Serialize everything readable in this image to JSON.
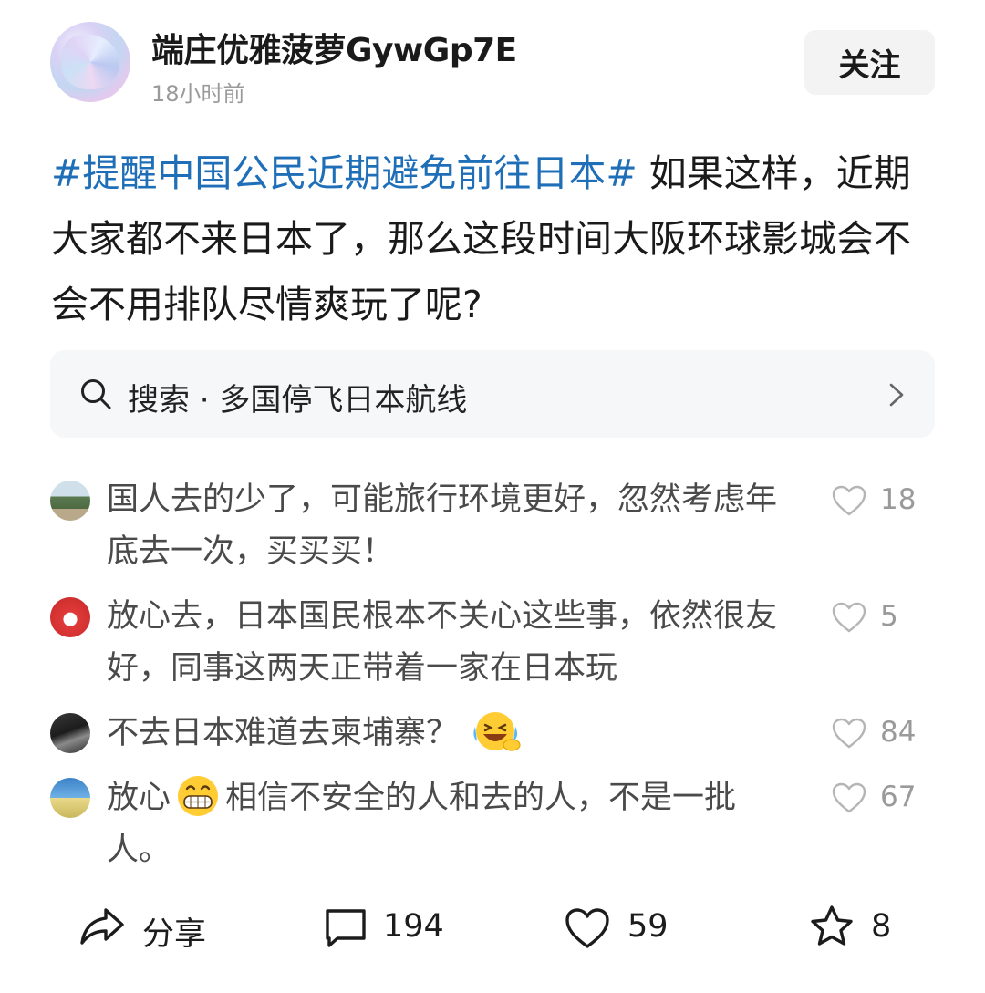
{
  "header": {
    "username": "端庄优雅菠萝GywGp7E",
    "time": "18小时前",
    "follow_label": "关注"
  },
  "post": {
    "hashtag": "#提醒中国公民近期避免前往日本#",
    "body": " 如果这样，近期大家都不来日本了，那么这段时间大阪环球影城会不会不用排队尽情爽玩了呢?"
  },
  "search": {
    "label": "搜索 · 多国停飞日本航线"
  },
  "comments": [
    {
      "text": "国人去的少了，可能旅行环境更好，忽然考虑年底去一次，买买买！",
      "likes": "18"
    },
    {
      "text": "放心去，日本国民根本不关心这些事，依然很友好，同事这两天正带着一家在日本玩",
      "likes": "5"
    },
    {
      "text": "不去日本难道去柬埔寨？",
      "likes": "84"
    },
    {
      "text_before": "放心",
      "text_after": "相信不安全的人和去的人，不是一批人。",
      "likes": "67"
    }
  ],
  "footer": {
    "share_label": "分享",
    "comments_count": "194",
    "likes_count": "59",
    "favorites_count": "8"
  }
}
